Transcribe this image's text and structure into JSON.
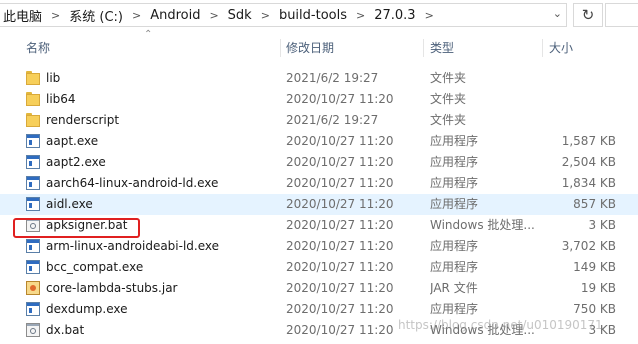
{
  "address_bar": {
    "crumbs": [
      "此电脑",
      "系统 (C:)",
      "Android",
      "Sdk",
      "build-tools",
      "27.0.3"
    ]
  },
  "columns": {
    "name": "名称",
    "date": "修改日期",
    "type": "类型",
    "size": "大小"
  },
  "files": [
    {
      "name": "lib",
      "date": "2021/6/2 19:27",
      "type": "文件夹",
      "size": "",
      "icon": "folder-icon"
    },
    {
      "name": "lib64",
      "date": "2020/10/27 11:20",
      "type": "文件夹",
      "size": "",
      "icon": "folder-icon"
    },
    {
      "name": "renderscript",
      "date": "2021/6/2 19:27",
      "type": "文件夹",
      "size": "",
      "icon": "folder-icon"
    },
    {
      "name": "aapt.exe",
      "date": "2020/10/27 11:20",
      "type": "应用程序",
      "size": "1,587 KB",
      "icon": "exe-icon"
    },
    {
      "name": "aapt2.exe",
      "date": "2020/10/27 11:20",
      "type": "应用程序",
      "size": "2,504 KB",
      "icon": "exe-icon"
    },
    {
      "name": "aarch64-linux-android-ld.exe",
      "date": "2020/10/27 11:20",
      "type": "应用程序",
      "size": "1,834 KB",
      "icon": "exe-icon"
    },
    {
      "name": "aidl.exe",
      "date": "2020/10/27 11:20",
      "type": "应用程序",
      "size": "857 KB",
      "icon": "exe-icon"
    },
    {
      "name": "apksigner.bat",
      "date": "2020/10/27 11:20",
      "type": "Windows 批处理...",
      "size": "3 KB",
      "icon": "bat-icon"
    },
    {
      "name": "arm-linux-androideabi-ld.exe",
      "date": "2020/10/27 11:20",
      "type": "应用程序",
      "size": "3,702 KB",
      "icon": "exe-icon"
    },
    {
      "name": "bcc_compat.exe",
      "date": "2020/10/27 11:20",
      "type": "应用程序",
      "size": "149 KB",
      "icon": "exe-icon"
    },
    {
      "name": "core-lambda-stubs.jar",
      "date": "2020/10/27 11:20",
      "type": "JAR 文件",
      "size": "19 KB",
      "icon": "jar-icon"
    },
    {
      "name": "dexdump.exe",
      "date": "2020/10/27 11:20",
      "type": "应用程序",
      "size": "750 KB",
      "icon": "exe-icon"
    },
    {
      "name": "dx.bat",
      "date": "2020/10/27 11:20",
      "type": "Windows 批处理...",
      "size": "3 KB",
      "icon": "bat-icon"
    }
  ],
  "watermark": "https://blog.csdn.net/u010190171",
  "colors": {
    "selected_row": "#e5f3ff",
    "highlight_border": "#e02020",
    "header_text": "#4c607a"
  }
}
